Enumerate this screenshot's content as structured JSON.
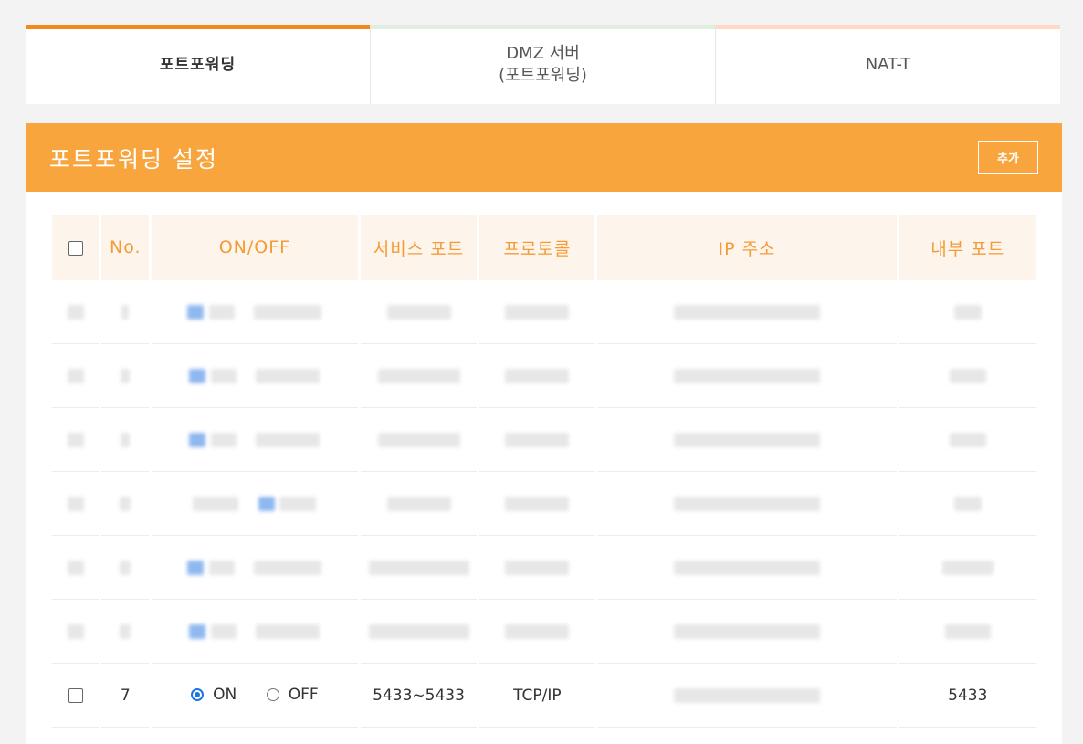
{
  "tabs": [
    {
      "label": "포트포워딩",
      "bar": "#f28a1a"
    },
    {
      "label": "DMZ 서버",
      "sub": "(포트포워딩)",
      "bar": "#dfeedd"
    },
    {
      "label": "NAT-T",
      "bar": "#ffd9c4"
    }
  ],
  "panel": {
    "title": "포트포워딩 설정",
    "add_label": "추가"
  },
  "table": {
    "headers": [
      "No.",
      "ON/OFF",
      "서비스 포트",
      "프로토콜",
      "IP 주소",
      "내부 포트"
    ],
    "rows": [
      {
        "no": "7",
        "on": "ON",
        "off": "OFF",
        "port": "5433~5433",
        "proto": "TCP/IP",
        "inner": "5433"
      }
    ]
  },
  "colors": {
    "accent": "#f9a53e",
    "header_text": "#f59b35",
    "radio": "#1e73e8"
  }
}
